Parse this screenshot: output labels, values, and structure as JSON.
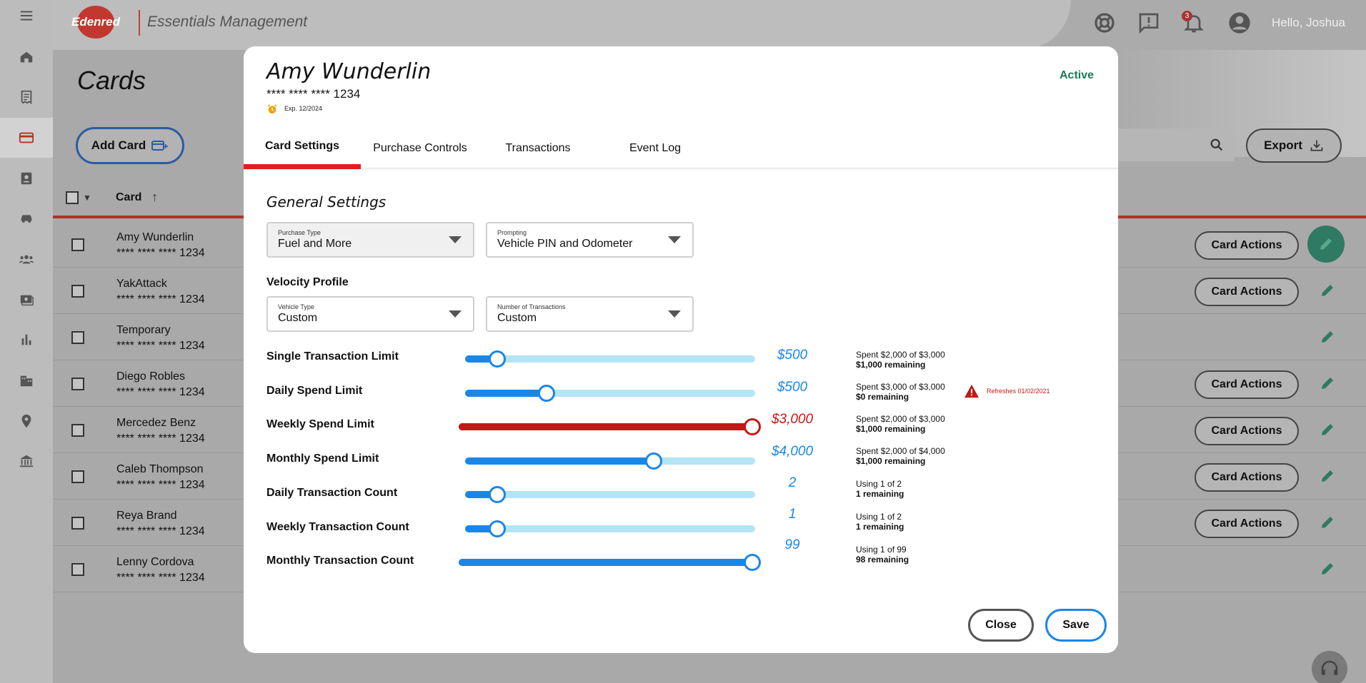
{
  "app": {
    "logo_text": "Edenred",
    "title": "Essentials Management",
    "greeting": "Hello, Joshua",
    "notification_count": "3"
  },
  "sidebar": {
    "items": [
      {
        "name": "home",
        "icon": "home-icon"
      },
      {
        "name": "reports",
        "icon": "receipt-icon"
      },
      {
        "name": "cards",
        "icon": "credit-card-icon",
        "active": true
      },
      {
        "name": "drivers",
        "icon": "badge-icon"
      },
      {
        "name": "vehicles",
        "icon": "car-icon"
      },
      {
        "name": "groups",
        "icon": "group-icon"
      },
      {
        "name": "payments",
        "icon": "money-icon"
      },
      {
        "name": "analytics",
        "icon": "bar-chart-icon"
      },
      {
        "name": "company",
        "icon": "building-icon"
      },
      {
        "name": "locations",
        "icon": "location-pin-icon"
      },
      {
        "name": "banking",
        "icon": "bank-icon"
      }
    ]
  },
  "page": {
    "title": "Cards",
    "add_card_label": "Add Card",
    "export_label": "Export",
    "column_card": "Card"
  },
  "rows": [
    {
      "name": "Amy Wunderlin",
      "number": "**** **** **** 1234",
      "actions": "Card Actions"
    },
    {
      "name": "YakAttack",
      "number": "**** **** **** 1234",
      "actions": "Card Actions"
    },
    {
      "name": "Temporary",
      "number": "**** **** **** 1234",
      "actions": ""
    },
    {
      "name": "Diego Robles",
      "number": "**** **** **** 1234",
      "actions": "Card Actions"
    },
    {
      "name": "Mercedez Benz",
      "number": "**** **** **** 1234",
      "actions": "Card Actions"
    },
    {
      "name": "Caleb Thompson",
      "number": "**** **** **** 1234",
      "actions": "Card Actions"
    },
    {
      "name": "Reya Brand",
      "number": "**** **** **** 1234",
      "actions": "Card Actions"
    },
    {
      "name": "Lenny Cordova",
      "number": "**** **** **** 1234",
      "actions": ""
    }
  ],
  "modal": {
    "cardholder": "Amy Wunderlin",
    "card_number": "**** **** **** 1234",
    "expiry": "Exp. 12/2024",
    "status": "Active",
    "tabs": [
      {
        "label": "Card Settings",
        "active": true
      },
      {
        "label": "Purchase Controls"
      },
      {
        "label": "Transactions"
      },
      {
        "label": "Event Log"
      }
    ],
    "general_settings_title": "General Settings",
    "purchase_type": {
      "label": "Purchase Type",
      "value": "Fuel and More"
    },
    "prompting": {
      "label": "Prompting",
      "value": "Vehicle PIN and Odometer"
    },
    "velocity_profile_title": "Velocity Profile",
    "vehicle_type": {
      "label": "Vehicle Type",
      "value": "Custom"
    },
    "number_of_transactions": {
      "label": "Number of Transactions",
      "value": "Custom"
    },
    "limits": [
      {
        "label": "Single Transaction Limit",
        "amount": "$500",
        "fraction": 0.11,
        "line1": "Spent $2,000 of $3,000",
        "line2": "$1,000 remaining",
        "color": "#1a86e8"
      },
      {
        "label": "Daily Spend Limit",
        "amount": "$500",
        "fraction": 0.28,
        "line1": "Spent $3,000 of $3,000",
        "line2": "$0 remaining",
        "color": "#1a86e8"
      },
      {
        "label": "Weekly Spend Limit",
        "amount": "$3,000",
        "fraction": 1.0,
        "line1": "Spent $2,000 of $3,000",
        "line2": "$1,000 remaining",
        "color": "#c41818"
      },
      {
        "label": "Monthly Spend Limit",
        "amount": "$4,000",
        "fraction": 0.65,
        "line1": "Spent $2,000 of $4,000",
        "line2": "$1,000 remaining",
        "color": "#1a86e8"
      },
      {
        "label": "Daily Transaction Count",
        "amount": "2",
        "fraction": 0.11,
        "line1": "Using 1 of 2",
        "line2": "1 remaining",
        "color": "#1a86e8"
      },
      {
        "label": "Weekly Transaction Count",
        "amount": "1",
        "fraction": 0.11,
        "line1": "Using 1 of 2",
        "line2": "1 remaining",
        "color": "#1a86e8"
      },
      {
        "label": "Monthly Transaction Count",
        "amount": "99",
        "fraction": 1.0,
        "line1": "Using 1 of 99",
        "line2": "98 remaining",
        "color": "#1a86e8"
      }
    ],
    "warning_text": "Refreshes 01/02/2021",
    "close_label": "Close",
    "save_label": "Save"
  }
}
